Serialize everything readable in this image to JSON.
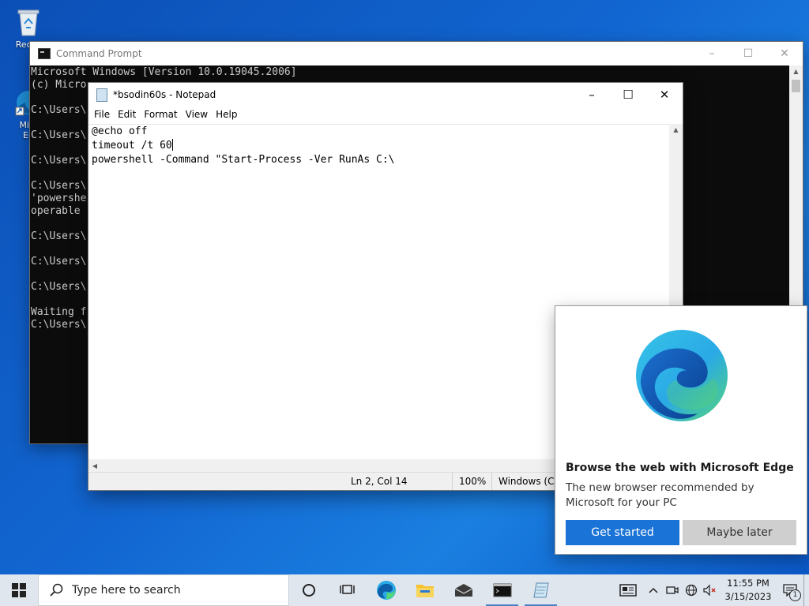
{
  "desktop": {
    "icons": [
      {
        "label": "Recycle Bin",
        "visible_label": "Recyc"
      },
      {
        "label": "Microsoft Edge",
        "visible_label": "Micr\nEd"
      }
    ]
  },
  "cmd": {
    "title": "Command Prompt",
    "lines": [
      "Microsoft Windows [Version 10.0.19045.2006]",
      "(c) Micro",
      "",
      "C:\\Users\\",
      "",
      "C:\\Users\\",
      "",
      "C:\\Users\\",
      "",
      "C:\\Users\\",
      "'powershe",
      "operable",
      "",
      "C:\\Users\\",
      "",
      "C:\\Users\\",
      "",
      "C:\\Users\\",
      "",
      "Waiting f",
      "C:\\Users\\"
    ]
  },
  "notepad": {
    "title": "*bsodin60s - Notepad",
    "menu": [
      "File",
      "Edit",
      "Format",
      "View",
      "Help"
    ],
    "lines": [
      "@echo off",
      "timeout /t 60",
      "powershell -Command \"Start-Process -Ver RunAs C:\\"
    ],
    "status": {
      "position": "Ln 2, Col 14",
      "zoom": "100%",
      "encoding": "Windows (CR"
    }
  },
  "edge_popup": {
    "heading": "Browse the web with Microsoft Edge",
    "body": "The new browser recommended by Microsoft for your PC",
    "primary_button": "Get started",
    "secondary_button": "Maybe later"
  },
  "taskbar": {
    "search_placeholder": "Type here to search",
    "apps": [
      "cortana-circle-icon",
      "task-view-icon",
      "edge-icon",
      "file-explorer-icon",
      "mail-icon",
      "command-prompt-icon",
      "notepad-icon"
    ],
    "tray": [
      "news-icon",
      "chevron-up-icon",
      "meet-now-icon",
      "network-icon",
      "volume-muted-icon"
    ],
    "time": "11:55 PM",
    "date": "3/15/2023",
    "notification_count": "1"
  },
  "colors": {
    "accent": "#1a73d6",
    "console_bg": "#0c0c0c",
    "console_fg": "#cccccc"
  }
}
